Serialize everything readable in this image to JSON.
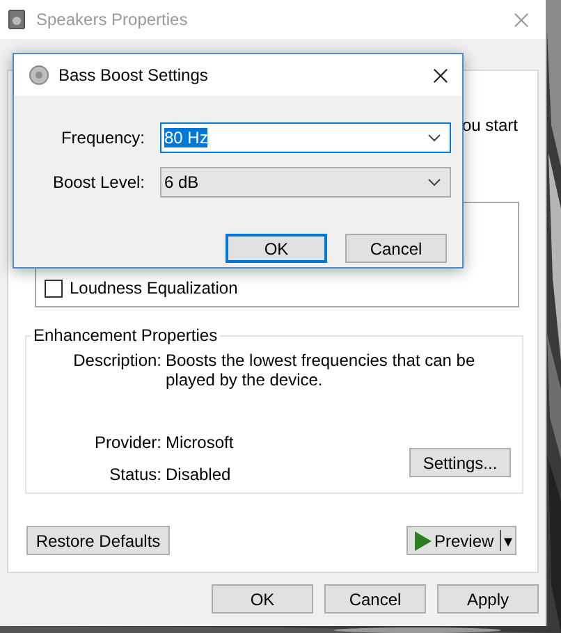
{
  "window": {
    "title": "Speakers Properties"
  },
  "panel_text": "ou start",
  "checkboxes": [
    {
      "label": "Loudness Equalization",
      "checked": false
    }
  ],
  "enhancement_properties": {
    "title": "Enhancement Properties",
    "fields": [
      {
        "label": "Description:",
        "value": "Boosts the lowest frequencies that can be played by the device."
      },
      {
        "label": "Provider:",
        "value": "Microsoft"
      },
      {
        "label": "Status:",
        "value": "Disabled"
      }
    ],
    "settings_button": "Settings..."
  },
  "restore_button": "Restore Defaults",
  "preview_button": {
    "label": "Preview",
    "arrow": "▾"
  },
  "buttons": [
    {
      "label": "OK"
    },
    {
      "label": "Cancel"
    },
    {
      "label": "Apply"
    }
  ],
  "dialog": {
    "title": "Bass Boost Settings",
    "fields": [
      {
        "label": "Frequency:",
        "value": "80 Hz",
        "focused": true
      },
      {
        "label": "Boost Level:",
        "value": "6 dB",
        "focused": false
      }
    ],
    "buttons": [
      {
        "label": "OK",
        "default": true
      },
      {
        "label": "Cancel",
        "default": false
      }
    ]
  }
}
